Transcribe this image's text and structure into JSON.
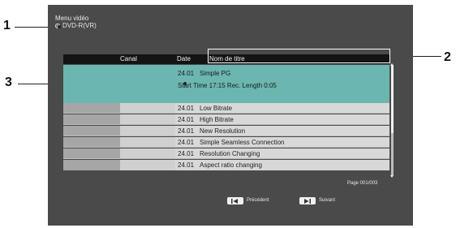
{
  "screen": {
    "menu_title": "Menu vidéo",
    "disc_label": "DVD-R(VR)"
  },
  "table": {
    "headers": {
      "canal": "Canal",
      "date": "Date",
      "title": "Nom de titre"
    },
    "selected": {
      "date": "24.01",
      "title": "Simple PG",
      "info": "Start Time 17:15 Rec. Length 0:05"
    },
    "rows": [
      {
        "date": "24.01",
        "title": "Low Bitrate"
      },
      {
        "date": "24.01",
        "title": "High Bitrate"
      },
      {
        "date": "24.01",
        "title": "New Resolution"
      },
      {
        "date": "24.01",
        "title": "Simple Seamless Connection"
      },
      {
        "date": "24.01",
        "title": "Resolution Changing"
      },
      {
        "date": "24.01",
        "title": "Aspect ratio changing"
      }
    ]
  },
  "page_indicator": "Page 001/003",
  "nav": {
    "prev_label": "Précédent",
    "next_label": "Suivant"
  },
  "callouts": {
    "one": "1",
    "two": "2",
    "three": "3"
  },
  "colors": {
    "screen_bg": "#4a4a4a",
    "selected_row": "#6bb6b0",
    "header_bg": "#141414"
  }
}
